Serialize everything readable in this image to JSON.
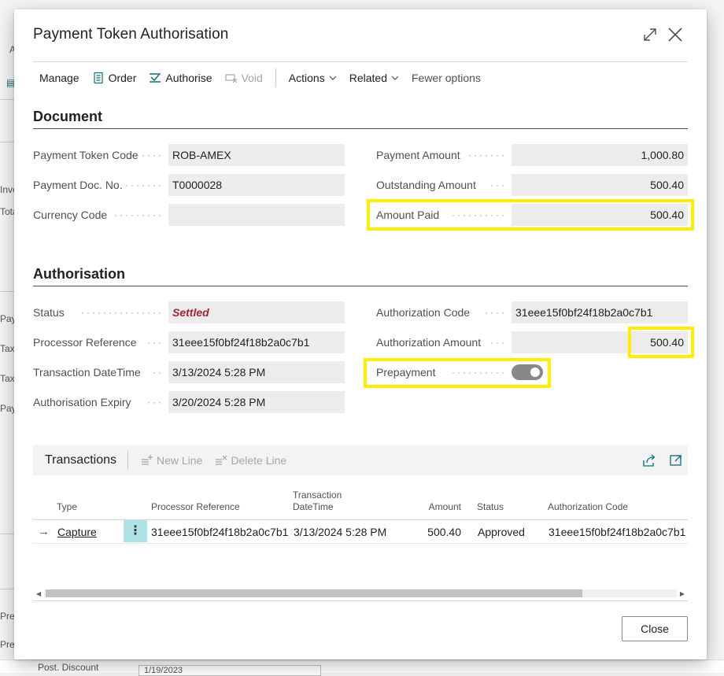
{
  "background": {
    "fragments": [
      "A",
      "Invo",
      "Tota",
      "Pay",
      "Tax",
      "Tax",
      "Pay",
      "Prep",
      "Prep"
    ],
    "bottom_label": "Post. Discount",
    "bottom_value": "1/19/2023"
  },
  "dialog": {
    "title": "Payment Token Authorisation",
    "actions": {
      "manage": "Manage",
      "order": "Order",
      "authorise": "Authorise",
      "void": "Void",
      "actions": "Actions",
      "related": "Related",
      "fewer": "Fewer options"
    },
    "document": {
      "heading": "Document",
      "payment_token_code": {
        "label": "Payment Token Code",
        "value": "ROB-AMEX"
      },
      "payment_doc_no": {
        "label": "Payment Doc. No.",
        "value": "T0000028"
      },
      "currency_code": {
        "label": "Currency Code",
        "value": ""
      },
      "payment_amount": {
        "label": "Payment Amount",
        "value": "1,000.80"
      },
      "outstanding_amount": {
        "label": "Outstanding Amount",
        "value": "500.40"
      },
      "amount_paid": {
        "label": "Amount Paid",
        "value": "500.40"
      }
    },
    "authorisation": {
      "heading": "Authorisation",
      "status": {
        "label": "Status",
        "value": "Settled"
      },
      "processor_reference": {
        "label": "Processor Reference",
        "value": "31eee15f0bf24f18b2a0c7b1"
      },
      "transaction_datetime": {
        "label": "Transaction DateTime",
        "value": "3/13/2024 5:28 PM"
      },
      "authorisation_expiry": {
        "label": "Authorisation Expiry",
        "value": "3/20/2024 5:28 PM"
      },
      "authorization_code": {
        "label": "Authorization Code",
        "value": "31eee15f0bf24f18b2a0c7b1"
      },
      "authorization_amount": {
        "label": "Authorization Amount",
        "value": "500.40"
      },
      "prepayment": {
        "label": "Prepayment",
        "value": true
      }
    },
    "transactions": {
      "title": "Transactions",
      "new_line": "New Line",
      "delete_line": "Delete Line",
      "columns": {
        "type": "Type",
        "processor_reference": "Processor Reference",
        "transaction_datetime_1": "Transaction",
        "transaction_datetime_2": "DateTime",
        "amount": "Amount",
        "status": "Status",
        "authorization_code": "Authorization Code"
      },
      "rows": [
        {
          "type": "Capture",
          "processor_reference": "31eee15f0bf24f18b2a0c7b1",
          "transaction_datetime": "3/13/2024 5:28 PM",
          "amount": "500.40",
          "status": "Approved",
          "authorization_code": "31eee15f0bf24f18b2a0c7b1"
        }
      ]
    },
    "close_label": "Close"
  },
  "colors": {
    "accent": "#0f6f7a",
    "highlight": "#ffee00",
    "settled": "#a4262c",
    "field_bg": "#ececec"
  }
}
